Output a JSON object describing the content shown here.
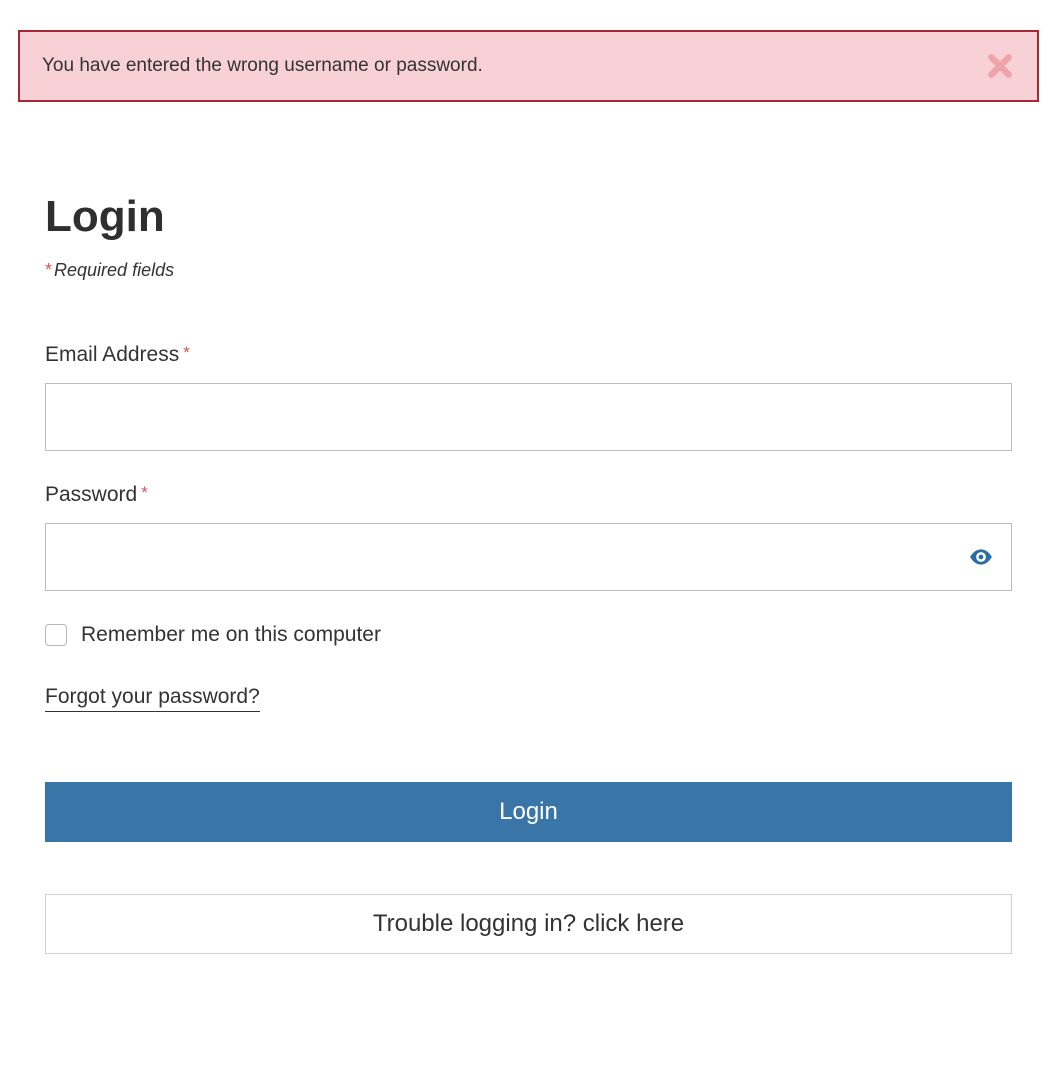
{
  "alert": {
    "message": "You have entered the wrong username or password."
  },
  "page": {
    "title": "Login",
    "required_note": "Required fields"
  },
  "form": {
    "email": {
      "label": "Email Address",
      "value": "",
      "placeholder": ""
    },
    "password": {
      "label": "Password",
      "value": "",
      "placeholder": ""
    },
    "remember": {
      "label": "Remember me on this computer",
      "checked": false
    },
    "forgot_link": "Forgot your password?",
    "login_button": "Login",
    "trouble_button": "Trouble logging in? click here"
  },
  "colors": {
    "primary": "#3a75a8",
    "alert_bg": "#f7d1d5",
    "alert_border": "#a52834",
    "required": "#d9534f"
  }
}
